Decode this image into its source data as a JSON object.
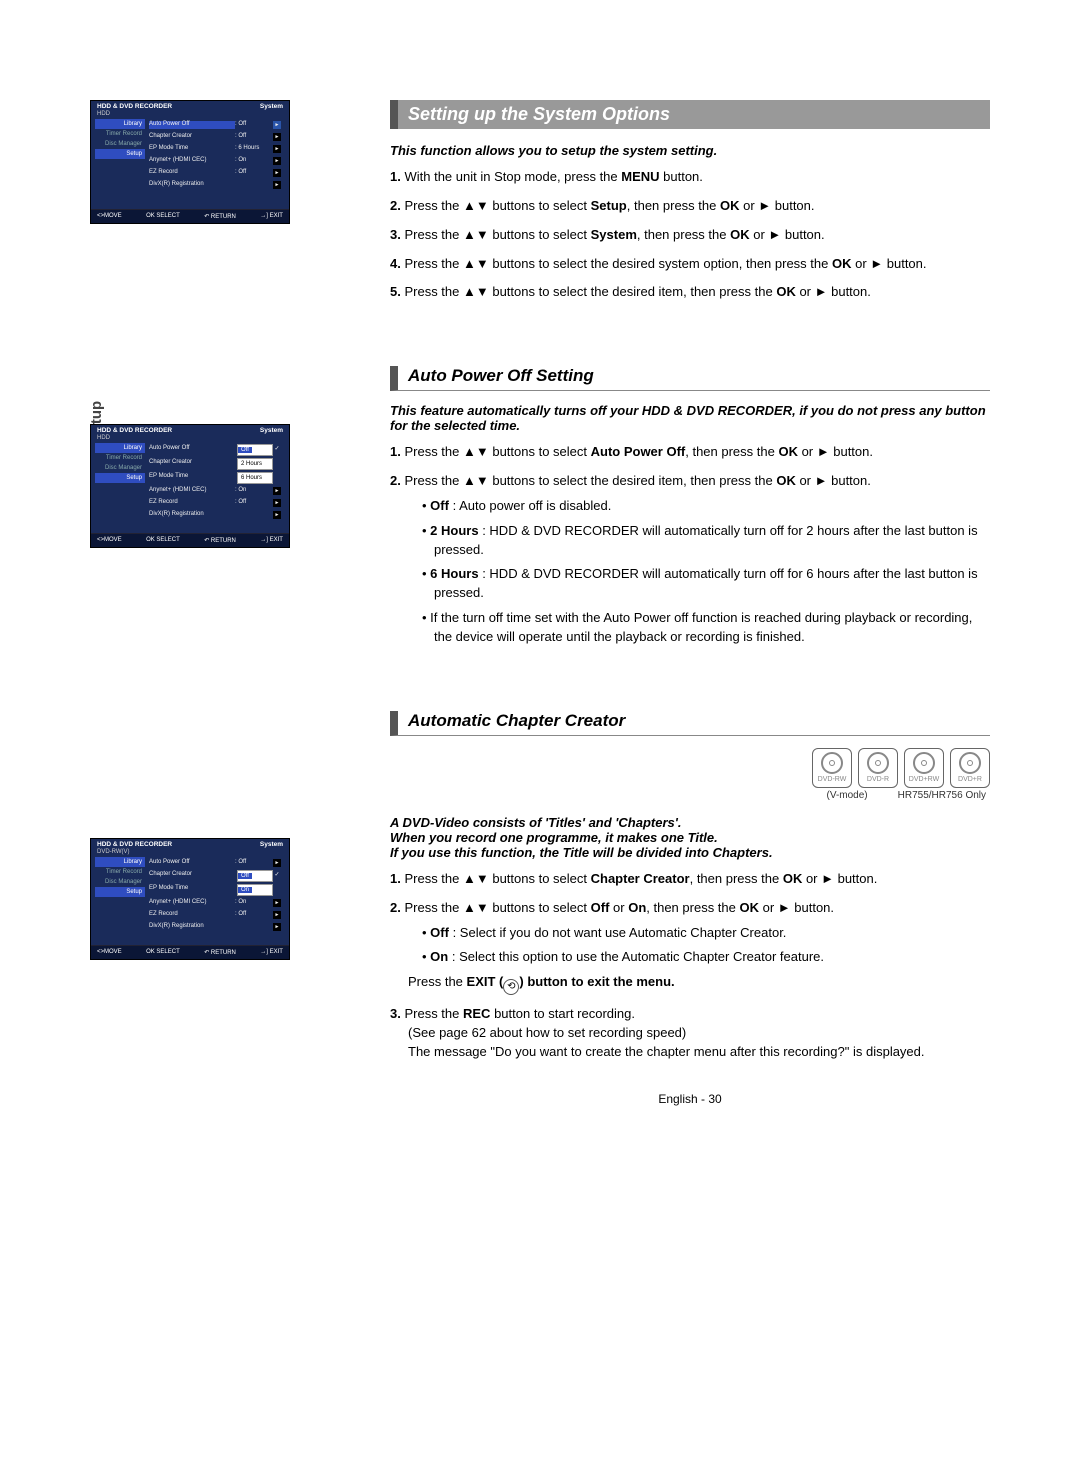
{
  "tab": "System Setup",
  "osd_common": {
    "title": "HDD & DVD RECORDER",
    "footer": {
      "move": "<>MOVE",
      "select": "OK SELECT",
      "return": "↶ RETURN",
      "exit": "→] EXIT"
    },
    "nav": [
      "Library",
      "Timer Record",
      "Disc Manager",
      "Setup"
    ]
  },
  "osd1": {
    "section": "System",
    "mode_badge": "HDD",
    "rows": [
      {
        "label": "Auto Power Off",
        "value": ": Off",
        "hl": true
      },
      {
        "label": "Chapter Creator",
        "value": ": Off"
      },
      {
        "label": "EP Mode Time",
        "value": ": 6 Hours"
      },
      {
        "label": "Anynet+ (HDMI CEC)",
        "value": ": On"
      },
      {
        "label": "EZ Record",
        "value": ": Off"
      },
      {
        "label": "DivX(R) Registration",
        "value": ""
      }
    ]
  },
  "osd2": {
    "section": "System",
    "mode_badge": "HDD",
    "rows": [
      {
        "label": "Auto Power Off",
        "value": "Off",
        "dd": true,
        "sel": true
      },
      {
        "label": "Chapter Creator",
        "value": "2 Hours",
        "dd": true
      },
      {
        "label": "EP Mode Time",
        "value": "6 Hours",
        "dd": true
      },
      {
        "label": "Anynet+ (HDMI CEC)",
        "value": ": On"
      },
      {
        "label": "EZ Record",
        "value": ": Off"
      },
      {
        "label": "DivX(R) Registration",
        "value": ""
      }
    ]
  },
  "osd3": {
    "section": "System",
    "mode_badge": "DVD-RW(V)",
    "rows": [
      {
        "label": "Auto Power Off",
        "value": ": Off"
      },
      {
        "label": "Chapter Creator",
        "value": "Off",
        "dd": true,
        "sel": true
      },
      {
        "label": "EP Mode Time",
        "value": "On",
        "dd": true
      },
      {
        "label": "Anynet+ (HDMI CEC)",
        "value": ": On"
      },
      {
        "label": "EZ Record",
        "value": ": Off"
      },
      {
        "label": "DivX(R) Registration",
        "value": ""
      }
    ]
  },
  "main": {
    "blockTitle": "Setting up the System Options",
    "lead1": "This function allows you to setup the system setting.",
    "s1": {
      "i1a": "With the unit in Stop mode, press the ",
      "i1b": "MENU",
      "i1c": " button.",
      "i2a": "Press the ▲▼ buttons to select ",
      "i2b": "Setup",
      "i2c": ", then press the ",
      "i2d": "OK",
      "i2e": " or ► button.",
      "i3a": "Press the ▲▼ buttons to select ",
      "i3b": "System",
      "i3c": ", then press the ",
      "i3d": "OK",
      "i3e": " or ► button.",
      "i4a": "Press the ▲▼ buttons to select the desired  system option, then press the ",
      "i4b": "OK",
      "i4c": " or ► button.",
      "i5a": "Press the ▲▼ buttons to select the desired item, then press the ",
      "i5b": "OK",
      "i5c": " or ► button."
    },
    "sec2Title": "Auto Power Off Setting",
    "lead2": "This feature automatically turns off your HDD & DVD RECORDER, if you do not press any button for the selected time.",
    "s2": {
      "i1a": "Press the ▲▼ buttons to select ",
      "i1b": "Auto Power Off",
      "i1c": ", then press the ",
      "i1d": "OK",
      "i1e": " or ► button.",
      "i2a": "Press the ▲▼ buttons to select the desired item, then press the ",
      "i2b": "OK",
      "i2c": " or ► button.",
      "b1a": "Off",
      "b1b": " : Auto power off is disabled.",
      "b2a": "2 Hours",
      "b2b": " : HDD & DVD RECORDER will automatically turn off for 2 hours after the last button is pressed.",
      "b3a": "6 Hours",
      "b3b": " : HDD & DVD RECORDER will automatically turn off for 6 hours after the last button is pressed.",
      "b4": "If the turn off time set with the Auto Power off function is reached during playback or recording, the device will operate until the playback or recording is finished."
    },
    "sec3Title": "Automatic Chapter Creator",
    "discs": [
      "DVD-RW",
      "DVD-R",
      "DVD+RW",
      "DVD+R"
    ],
    "discCap1": "(V-mode)",
    "discCap2": "HR755/HR756 Only",
    "lead3": "A DVD-Video consists of 'Titles' and 'Chapters'.\nWhen you record one programme, it makes one Title.\nIf you use this function, the Title will be divided into Chapters.",
    "s3": {
      "i1a": "Press the ▲▼ buttons to select ",
      "i1b": "Chapter Creator",
      "i1c": ", then press the ",
      "i1d": "OK",
      "i1e": " or ► button.",
      "i2a": "Press the ▲▼ buttons to select ",
      "i2b": "Off",
      "i2c": " or ",
      "i2d": "On",
      "i2e": ", then press the ",
      "i2f": "OK",
      "i2g": " or ► button.",
      "b1a": "Off",
      "b1b": " : Select if you do not want use Automatic Chapter Creator.",
      "b2a": "On",
      "b2b": " : Select this option to use the Automatic Chapter Creator feature.",
      "exitLine1": "Press the ",
      "exitLine2": "EXIT (",
      "exitLine3": ") button to exit the menu.",
      "i3a": "Press the ",
      "i3b": "REC",
      "i3c": " button to start recording.",
      "i3d": "(See page 62 about how to set recording speed)",
      "i3e": "The message \"Do you want to create the chapter menu after this recording?\" is displayed."
    },
    "pageNum": "English - 30"
  }
}
